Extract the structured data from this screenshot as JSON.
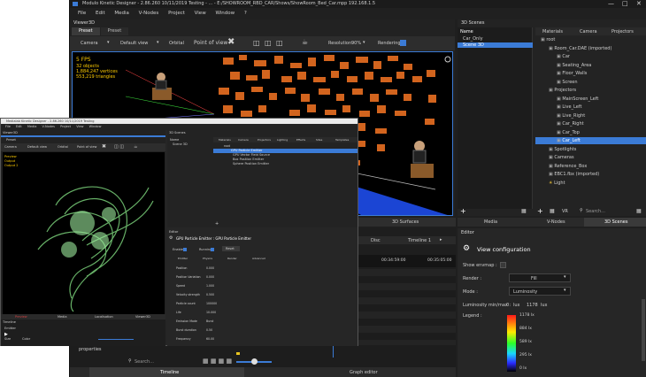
{
  "main": {
    "title": "Modulo Kinetic Designer - 2.86.260 10/11/2019 Testing - ... - E:/SHOWROOM_RBD_CAR/Shows/ShowRoom_Bed_Car.mpp  192.168.1.5",
    "menu": [
      "File",
      "Edit",
      "Media",
      "V-Nodes",
      "Project",
      "View",
      "Window",
      "?"
    ],
    "viewer_title": "Viewer3D",
    "viewer_tabs": [
      "Preset",
      "Preset"
    ],
    "toolbar": {
      "camera": "Camera",
      "default_view": "Default view",
      "orbital": "Orbital",
      "point_of_view": "Point of view",
      "resolution_label": "Resolution:",
      "resolution_value": "90%",
      "rendering_label": "Rendering:"
    },
    "stats": [
      "5 FPS",
      "32 objects",
      "1,884,247 vertices",
      "553,219 triangles"
    ],
    "scenes": {
      "title": "3D Scenes",
      "name_header": "Name",
      "items": [
        "Car_Only",
        "Scene 3D"
      ],
      "tree_tabs": [
        "Materials",
        "Camera",
        "Projectors"
      ],
      "tree": [
        {
          "label": "root",
          "indent": 0
        },
        {
          "label": "Room_Car.DAE (imported)",
          "indent": 1
        },
        {
          "label": "Car",
          "indent": 2
        },
        {
          "label": "Seating_Area",
          "indent": 2
        },
        {
          "label": "Floor_Walls",
          "indent": 2
        },
        {
          "label": "Screen",
          "indent": 2
        },
        {
          "label": "Projectors",
          "indent": 1
        },
        {
          "label": "MainScreen_Left",
          "indent": 2
        },
        {
          "label": "Live_Left",
          "indent": 2
        },
        {
          "label": "Live_Right",
          "indent": 2
        },
        {
          "label": "Car_Right",
          "indent": 2
        },
        {
          "label": "Car_Top",
          "indent": 2
        },
        {
          "label": "Car_Left",
          "indent": 2,
          "selected": true
        },
        {
          "label": "Spotlights",
          "indent": 1
        },
        {
          "label": "Cameras",
          "indent": 1
        },
        {
          "label": "Reference_Box",
          "indent": 1
        },
        {
          "label": "EBC1.fbx (imported)",
          "indent": 1
        },
        {
          "label": "Light",
          "indent": 1
        }
      ],
      "vr_label": "VR",
      "search_placeholder": "Search..."
    },
    "bottom_tabs": [
      "Media",
      "V-Nodes",
      "3D Scenes"
    ],
    "surface_tab": "3D Surfaces",
    "timeline": {
      "tabs": [
        "Disc",
        "Timeline 1"
      ],
      "times": [
        "00:34:59:00",
        "00:35:05:00"
      ],
      "properties": "properties",
      "search_placeholder": "Search...",
      "bottom_tabs": [
        "Timeline",
        "Graph editor"
      ]
    },
    "editor": {
      "title": "Editor",
      "heading": "View configuration",
      "show_envmap": "Show envmap :",
      "render_label": "Render :",
      "render_value": "Fill",
      "mode_label": "Mode :",
      "mode_value": "Luminosity",
      "luminosity_label": "Luminosity min/max :",
      "lum_min": "0",
      "lum_min_unit": "lux",
      "lum_max": "1178",
      "lum_max_unit": "lux",
      "legend_label": "Legend :",
      "legend_values": [
        "1178 lx",
        "884 lx",
        "589 lx",
        "295 lx",
        "0 lx"
      ]
    }
  },
  "sub": {
    "title": "Medialab Kinetic Designer - 2.86.260 10/11/2019 Testing",
    "menu": [
      "File",
      "Edit",
      "Media",
      "V-Nodes",
      "Project",
      "View",
      "Window"
    ],
    "viewer_title": "Viewer3D",
    "viewer_tab": "Preset",
    "toolbar": [
      "Camera",
      "Default view",
      "Orbital",
      "Point of view"
    ],
    "stats": [
      "Preview",
      "Output",
      "Output 2"
    ],
    "scenes_title": "3D Scenes",
    "name_header": "Name",
    "scene_item": "Scene 3D",
    "tree_tabs": [
      "Materials",
      "Camera",
      "Projectors",
      "Lighting",
      "Effects",
      "Sites",
      "Templates"
    ],
    "tree": [
      "root",
      "GPU Particle Emitter",
      "GPU Vector Field Source",
      "Box Position Emitter",
      "Sphere Position Emitter"
    ],
    "bottom_tabs": [
      "Preview",
      "Media",
      "Localisation",
      "Viewer3D"
    ],
    "timeline_title": "Timeline",
    "timeline_rows": [
      "Emitter",
      "Size",
      "Color"
    ],
    "editor_title": "Editor",
    "editor_heading": "GPU Particle Emitter : GPU Particle Emitter",
    "editor_enabled": "Enabled",
    "editor_running": "Running",
    "editor_reset": "Reset",
    "editor_tabs": [
      "Emitter",
      "Physics",
      "Render",
      "Advanced"
    ],
    "fields": [
      {
        "label": "Position",
        "value": "0.000"
      },
      {
        "label": "Position Variation",
        "value": "0.000"
      },
      {
        "label": "Speed",
        "value": "1.000"
      },
      {
        "label": "Velocity strength",
        "value": "0.500"
      },
      {
        "label": "Particle count",
        "value": "100000"
      },
      {
        "label": "Life",
        "value": "10.000"
      },
      {
        "label": "Emission Mode",
        "value": "Burst"
      },
      {
        "label": "Burst duration",
        "value": "0.50"
      },
      {
        "label": "Frequency",
        "value": "60.00"
      }
    ]
  },
  "colors": {
    "accent": "#3b7bd6",
    "selection": "#3b7bd6",
    "orange": "#d2641e",
    "particles": "#7ad07a"
  }
}
